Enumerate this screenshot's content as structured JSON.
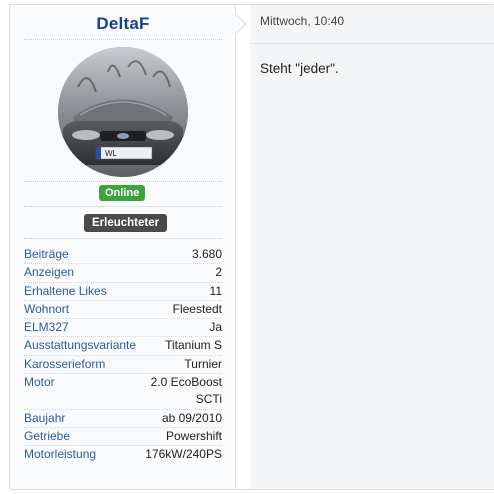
{
  "user": {
    "name": "DeltaF",
    "online_label": "Online",
    "rank_label": "Erleuchteter"
  },
  "stats": [
    {
      "label": "Beiträge",
      "value": "3.680"
    },
    {
      "label": "Anzeigen",
      "value": "2"
    },
    {
      "label": "Erhaltene Likes",
      "value": "11"
    },
    {
      "label": "Wohnort",
      "value": "Fleestedt"
    },
    {
      "label": "ELM327",
      "value": "Ja"
    },
    {
      "label": "Ausstattungsvariante",
      "value": "Titanium S"
    },
    {
      "label": "Karosserieform",
      "value": "Turnier"
    },
    {
      "label": "Motor",
      "value": "2.0 EcoBoost SCTi"
    },
    {
      "label": "Baujahr",
      "value": "ab 09/2010"
    },
    {
      "label": "Getriebe",
      "value": "Powershift"
    },
    {
      "label": "Motorleistung",
      "value": "176kW/240PS"
    }
  ],
  "post": {
    "timestamp": "Mittwoch, 10:40",
    "message": "Steht \"jeder\"."
  },
  "colors": {
    "username": "#14428f",
    "label": "#2d5aa0",
    "online": "#3ca43a",
    "rank": "#4a4a4a"
  },
  "icons": {
    "avatar": "car-avatar"
  }
}
